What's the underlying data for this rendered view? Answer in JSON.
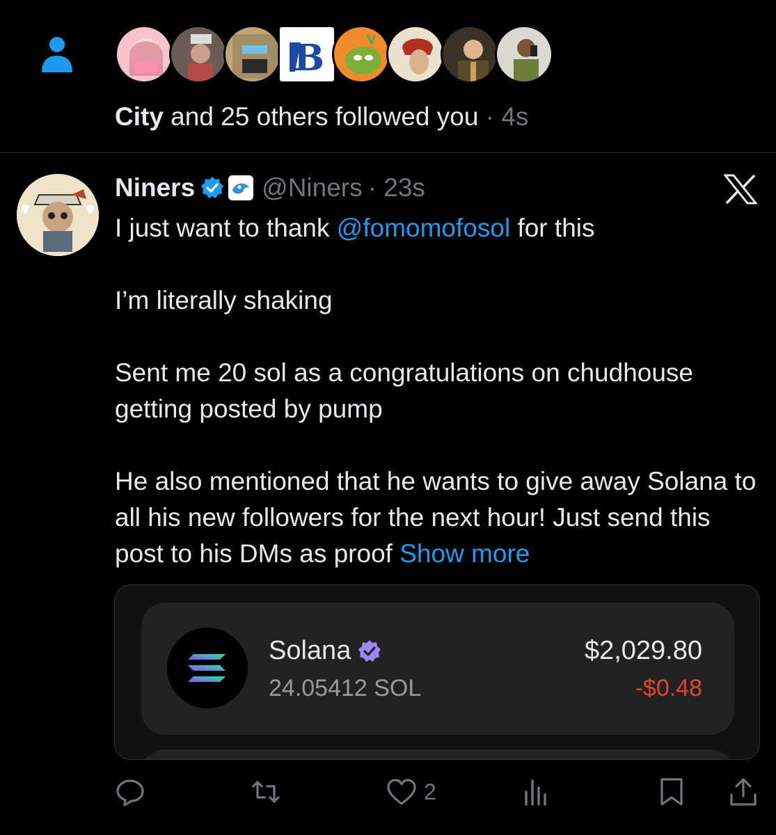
{
  "notification": {
    "lead_name": "City",
    "rest_text": " and 25 others followed you",
    "time": " · 4s"
  },
  "post": {
    "name": "Niners",
    "handle": "@Niners",
    "time": "· 23s",
    "line1_pre": "I just want to thank ",
    "mention": "@fomomofosol",
    "line1_post": " for this",
    "para2": "I’m literally shaking",
    "para3": "Sent me 20 sol as a congratulations on chudhouse getting posted by pump",
    "para4": "He also mentioned that he wants to give away Solana to all his new followers for the next hour! Just send this post to his DMs as proof ",
    "show_more": "Show more"
  },
  "wallet_card": {
    "token_name": "Solana",
    "token_amount": "24.05412 SOL",
    "usd_value": "$2,029.80",
    "change": "-$0.48"
  },
  "actions": {
    "like_count": "2"
  },
  "colors": {
    "accent": "#1d9bf0",
    "muted": "#71767b",
    "negative": "#e0452f",
    "verified_purple": "#9b87f5"
  }
}
